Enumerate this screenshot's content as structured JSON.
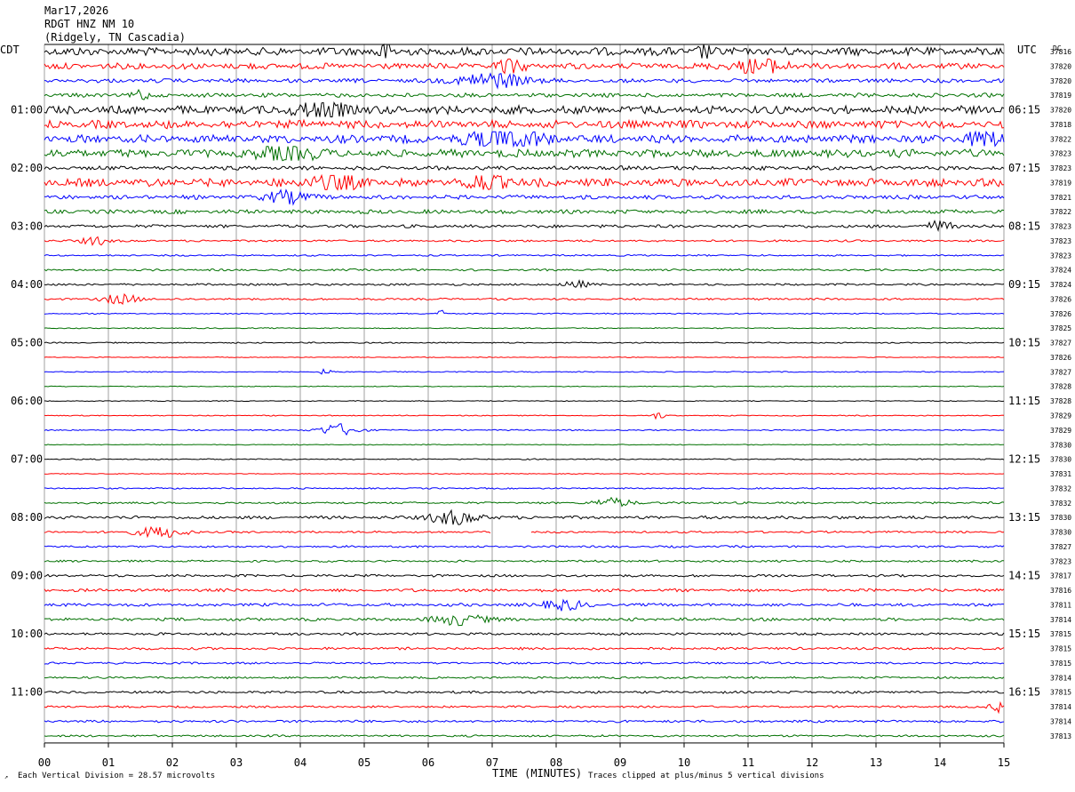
{
  "header": {
    "date": "Mar17,2026",
    "station": "RDGT HNZ NM 10",
    "location": "(Ridgely, TN Cascadia)"
  },
  "labels": {
    "left_zone": "CDT",
    "right_zone": "UTC",
    "dc_label": "DC"
  },
  "footer": {
    "scale": "Each Vertical Division =   28.57 microvolts",
    "xlabel": "TIME (MINUTES)",
    "clip_note": "Traces clipped at plus/minus 5 vertical divisions"
  },
  "chart_data": {
    "type": "line",
    "title": "RDGT HNZ NM 10",
    "xlabel": "TIME (MINUTES)",
    "ylabel": "",
    "xlim": [
      0,
      15
    ],
    "x_ticks": [
      "00",
      "01",
      "02",
      "03",
      "04",
      "05",
      "06",
      "07",
      "08",
      "09",
      "10",
      "11",
      "12",
      "13",
      "14",
      "15"
    ],
    "trace_colors": [
      "#000000",
      "#ff0000",
      "#0000ff",
      "#007000"
    ],
    "left_hour_labels": [
      "01:00",
      "02:00",
      "03:00",
      "04:00",
      "05:00",
      "06:00",
      "07:00",
      "08:00",
      "09:00",
      "10:00",
      "11:00"
    ],
    "right_hour_labels": [
      "06:15",
      "07:15",
      "08:15",
      "09:15",
      "10:15",
      "11:15",
      "12:15",
      "13:15",
      "14:15",
      "15:15",
      "16:15"
    ],
    "dc_offsets": [
      "37816",
      "37820",
      "37820",
      "37819",
      "37820",
      "37818",
      "37822",
      "37823",
      "37823",
      "37819",
      "37821",
      "37822",
      "37823",
      "37823",
      "37823",
      "37824",
      "37824",
      "37826",
      "37826",
      "37825",
      "37827",
      "37826",
      "37827",
      "37828",
      "37828",
      "37829",
      "37829",
      "37830",
      "37830",
      "37831",
      "37832",
      "37832",
      "37830",
      "37830",
      "37827",
      "37823",
      "37817",
      "37816",
      "37811",
      "37814",
      "37815",
      "37815",
      "37815",
      "37814",
      "37815",
      "37814",
      "37814",
      "37813"
    ],
    "trace_activity": [
      4,
      3,
      2,
      2,
      4,
      4,
      4,
      4,
      2,
      4,
      2,
      2,
      1.5,
      1,
      0.8,
      1,
      1,
      1,
      0.6,
      0.5,
      0.6,
      0.4,
      0.5,
      0.4,
      0.4,
      0.5,
      0.6,
      0.4,
      0.6,
      0.4,
      0.7,
      1,
      1.5,
      1,
      1,
      1,
      1.2,
      1.5,
      1.5,
      1.5,
      1.2,
      1.2,
      1,
      1,
      1.2,
      1,
      1.2,
      1
    ],
    "events": [
      {
        "trace": 0,
        "minute": 5.3,
        "amp": 10,
        "width": 0.15
      },
      {
        "trace": 0,
        "minute": 10.3,
        "amp": 8,
        "width": 0.1
      },
      {
        "trace": 1,
        "minute": 7.3,
        "amp": 9,
        "width": 0.2
      },
      {
        "trace": 1,
        "minute": 11.2,
        "amp": 9,
        "width": 0.4
      },
      {
        "trace": 2,
        "minute": 7.0,
        "amp": 10,
        "width": 0.5
      },
      {
        "trace": 3,
        "minute": 1.5,
        "amp": 7,
        "width": 0.1
      },
      {
        "trace": 4,
        "minute": 4.3,
        "amp": 12,
        "width": 0.4
      },
      {
        "trace": 6,
        "minute": 7.2,
        "amp": 14,
        "width": 0.5
      },
      {
        "trace": 6,
        "minute": 14.7,
        "amp": 9,
        "width": 0.3
      },
      {
        "trace": 7,
        "minute": 3.8,
        "amp": 8,
        "width": 0.4
      },
      {
        "trace": 9,
        "minute": 6.9,
        "amp": 10,
        "width": 0.3
      },
      {
        "trace": 9,
        "minute": 4.5,
        "amp": 8,
        "width": 0.4
      },
      {
        "trace": 10,
        "minute": 3.8,
        "amp": 8,
        "width": 0.3
      },
      {
        "trace": 12,
        "minute": 14.0,
        "amp": 6,
        "width": 0.2
      },
      {
        "trace": 13,
        "minute": 0.8,
        "amp": 5,
        "width": 0.2
      },
      {
        "trace": 16,
        "minute": 8.3,
        "amp": 4,
        "width": 0.2
      },
      {
        "trace": 17,
        "minute": 1.2,
        "amp": 5,
        "width": 0.3
      },
      {
        "trace": 18,
        "minute": 6.2,
        "amp": 6,
        "width": 0.05
      },
      {
        "trace": 22,
        "minute": 4.4,
        "amp": 3,
        "width": 0.1
      },
      {
        "trace": 25,
        "minute": 9.6,
        "amp": 4,
        "width": 0.1
      },
      {
        "trace": 26,
        "minute": 4.6,
        "amp": 7,
        "width": 0.3
      },
      {
        "trace": 31,
        "minute": 8.9,
        "amp": 5,
        "width": 0.3
      },
      {
        "trace": 32,
        "minute": 6.4,
        "amp": 8,
        "width": 0.4
      },
      {
        "trace": 33,
        "minute": 1.8,
        "amp": 6,
        "width": 0.4
      },
      {
        "trace": 38,
        "minute": 8.1,
        "amp": 6,
        "width": 0.3
      },
      {
        "trace": 39,
        "minute": 6.5,
        "amp": 6,
        "width": 0.4
      },
      {
        "trace": 45,
        "minute": 15.0,
        "amp": 7,
        "width": 0.2
      }
    ],
    "gaps": [
      {
        "trace": 33,
        "from_minute": 7.0,
        "to_minute": 7.6
      }
    ]
  }
}
